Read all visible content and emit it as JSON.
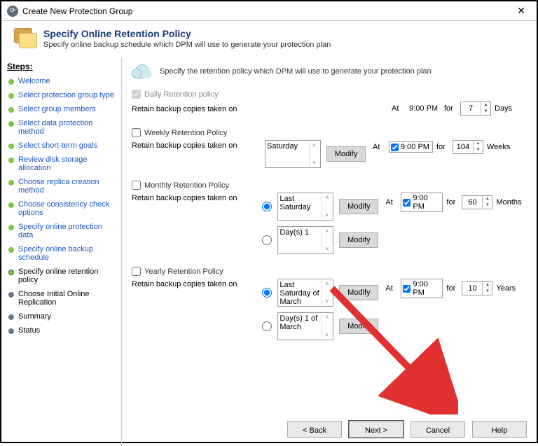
{
  "window": {
    "title": "Create New Protection Group"
  },
  "header": {
    "title": "Specify Online Retention Policy",
    "subtitle": "Specify online backup schedule which DPM will use to generate your protection plan"
  },
  "sidebar": {
    "heading": "Steps:",
    "items": [
      {
        "label": "Welcome",
        "state": "done"
      },
      {
        "label": "Select protection group type",
        "state": "done"
      },
      {
        "label": "Select group members",
        "state": "done"
      },
      {
        "label": "Select data protection method",
        "state": "done"
      },
      {
        "label": "Select short-term goals",
        "state": "done"
      },
      {
        "label": "Review disk storage allocation",
        "state": "done"
      },
      {
        "label": "Choose replica creation method",
        "state": "done"
      },
      {
        "label": "Choose consistency check options",
        "state": "done"
      },
      {
        "label": "Specify online protection data",
        "state": "done"
      },
      {
        "label": "Specify online backup schedule",
        "state": "done"
      },
      {
        "label": "Specify online retention policy",
        "state": "current"
      },
      {
        "label": "Choose Initial Online Replication",
        "state": "future"
      },
      {
        "label": "Summary",
        "state": "future"
      },
      {
        "label": "Status",
        "state": "future"
      }
    ]
  },
  "content": {
    "intro": "Specify the retention policy which DPM will use to generate your protection plan",
    "at": "At",
    "for": "for",
    "modify": "Modify",
    "daily": {
      "label": "Daily Retention policy",
      "retain": "Retain backup copies taken on",
      "time": "9:00 PM",
      "value": "7",
      "unit": "Days"
    },
    "weekly": {
      "label": "Weekly Retention Policy",
      "retain": "Retain backup copies taken on",
      "schedule": "Saturday",
      "time": "9:00 PM",
      "value": "104",
      "unit": "Weeks"
    },
    "monthly": {
      "label": "Monthly Retention Policy",
      "retain": "Retain backup copies taken on",
      "opt1": "Last Saturday",
      "opt2": "Day(s) 1",
      "time": "9:00 PM",
      "value": "60",
      "unit": "Months"
    },
    "yearly": {
      "label": "Yearly Retention Policy",
      "retain": "Retain backup copies taken on",
      "opt1": "Last Saturday of March",
      "opt2": "Day(s) 1 of March",
      "time": "9:00 PM",
      "value": "10",
      "unit": "Years"
    }
  },
  "footer": {
    "back": "< Back",
    "next": "Next >",
    "cancel": "Cancel",
    "help": "Help"
  }
}
